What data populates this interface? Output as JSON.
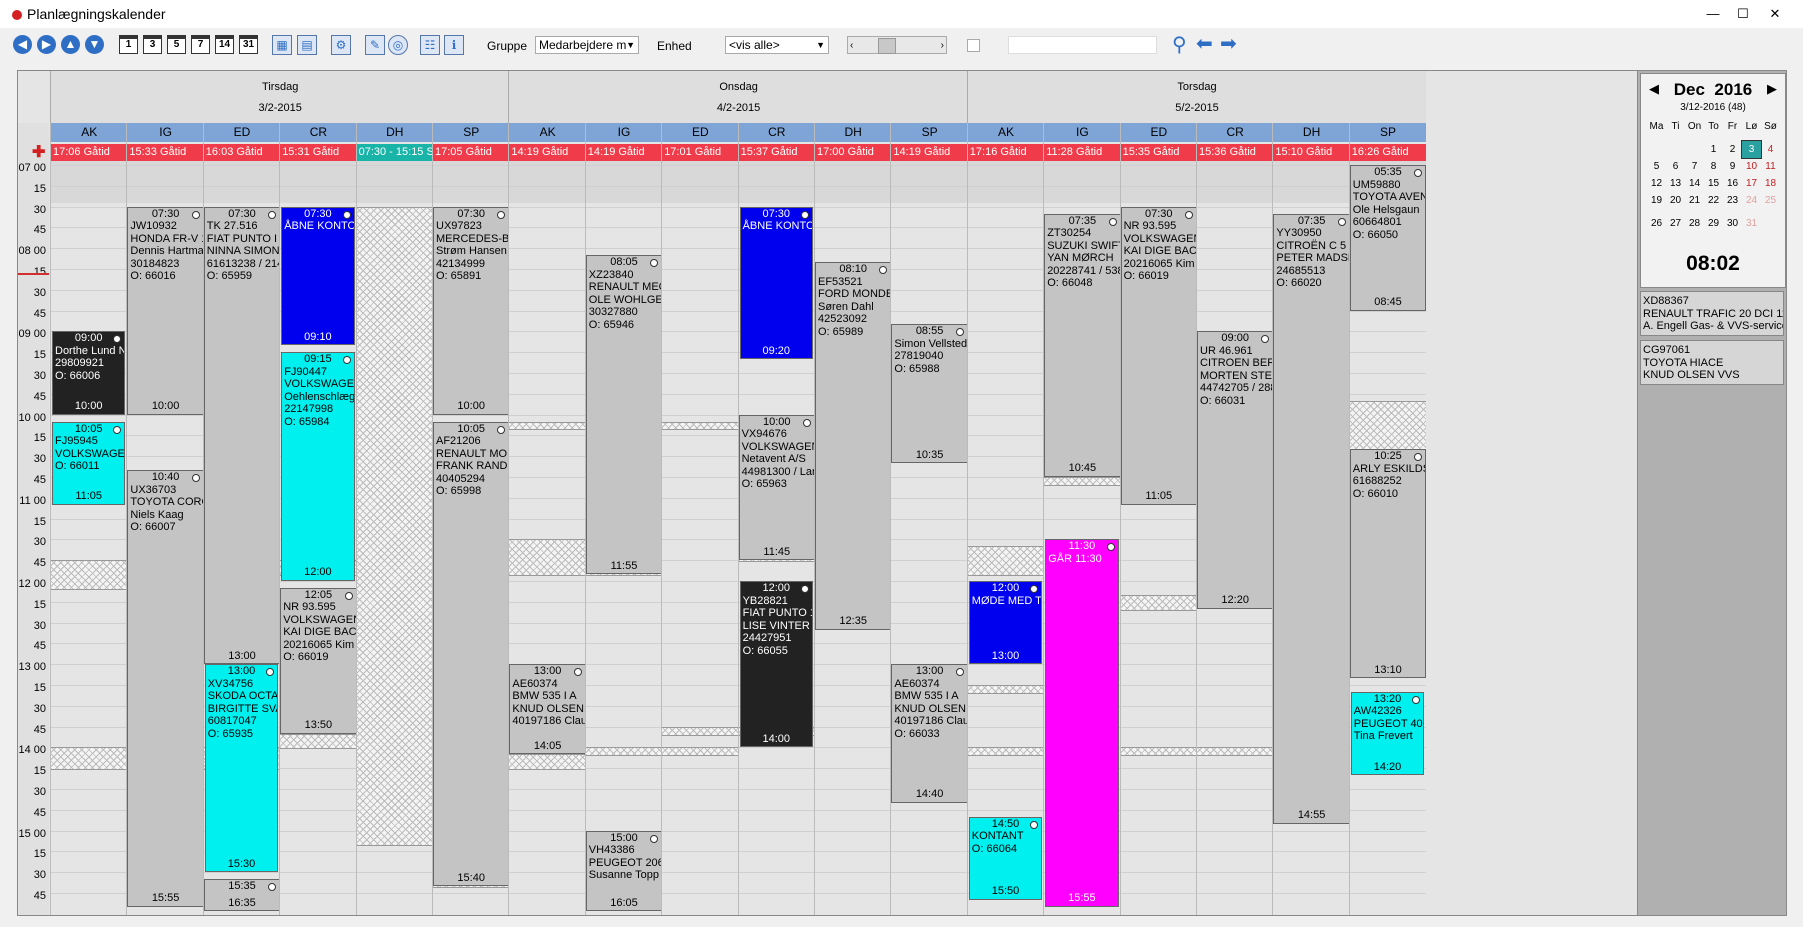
{
  "window": {
    "title": "Planlægningskalender",
    "min": "—",
    "max": "☐",
    "close": "✕"
  },
  "toolbar": {
    "nav_icons": [
      "left-arrow-icon",
      "right-arrow-icon",
      "up-arrow-icon",
      "down-arrow-icon"
    ],
    "day_buttons": [
      "1",
      "3",
      "5",
      "7",
      "14",
      "31"
    ],
    "gruppe_label": "Gruppe",
    "gruppe_value": "Medarbejdere m",
    "enhed_label": "Enhed",
    "enhed_value": "<vis alle>"
  },
  "days": [
    {
      "name": "Tirsdag",
      "date": "3/2-2015"
    },
    {
      "name": "Onsdag",
      "date": "4/2-2015"
    },
    {
      "name": "Torsdag",
      "date": "5/2-2015"
    }
  ],
  "columns": [
    {
      "abbr": "AK",
      "status": "17:06 Gåtid"
    },
    {
      "abbr": "IG",
      "status": "15:33 Gåtid"
    },
    {
      "abbr": "ED",
      "status": "16:03 Gåtid"
    },
    {
      "abbr": "CR",
      "status": "15:31 Gåtid"
    },
    {
      "abbr": "DH",
      "status": "07:30 - 15:15 Sy"
    },
    {
      "abbr": "SP",
      "status": "17:05 Gåtid"
    },
    {
      "abbr": "AK",
      "status": "14:19 Gåtid"
    },
    {
      "abbr": "IG",
      "status": "14:19 Gåtid"
    },
    {
      "abbr": "ED",
      "status": "17:01 Gåtid"
    },
    {
      "abbr": "CR",
      "status": "15:37 Gåtid"
    },
    {
      "abbr": "DH",
      "status": "17:00 Gåtid"
    },
    {
      "abbr": "SP",
      "status": "14:19 Gåtid"
    },
    {
      "abbr": "AK",
      "status": "17:16 Gåtid"
    },
    {
      "abbr": "IG",
      "status": "11:28 Gåtid"
    },
    {
      "abbr": "ED",
      "status": "15:35 Gåtid"
    },
    {
      "abbr": "CR",
      "status": "15:36 Gåtid"
    },
    {
      "abbr": "DH",
      "status": "15:10 Gåtid"
    },
    {
      "abbr": "SP",
      "status": "16:26 Gåtid"
    }
  ],
  "times": [
    "07 00",
    "15",
    "30",
    "45",
    "08 00",
    "15",
    "30",
    "45",
    "09 00",
    "15",
    "30",
    "45",
    "10 00",
    "15",
    "30",
    "45",
    "11 00",
    "15",
    "30",
    "45",
    "12 00",
    "15",
    "30",
    "45",
    "13 00",
    "15",
    "30",
    "45",
    "14 00",
    "15",
    "30",
    "45",
    "15 00",
    "15",
    "30",
    "45"
  ],
  "events": [
    {
      "col": 0,
      "start": "09:00",
      "end": "10:00",
      "color": "black",
      "text": "Dorthe Lund Niel\n29809921\nO: 66006"
    },
    {
      "col": 0,
      "start": "10:05",
      "end": "11:05",
      "color": "cyan",
      "text": "FJ95945\nVOLKSWAGEN\nO: 66011"
    },
    {
      "col": 1,
      "start": "07:30",
      "end": "10:00",
      "color": "gray",
      "text": "JW10932\nHONDA FR-V 18\nDennis Hartman\n30184823\nO: 66016"
    },
    {
      "col": 1,
      "start": "10:40",
      "end": "15:55",
      "color": "gray",
      "text": "UX36703\nTOYOTA CORO\nNiels Kaag\nO: 66007"
    },
    {
      "col": 2,
      "start": "07:30",
      "end": "13:00",
      "color": "gray",
      "text": "TK 27.516\nFIAT PUNTO I\nNINNA SIMONS\n61613238 / 214\nO: 65959"
    },
    {
      "col": 2,
      "start": "13:00",
      "end": "15:30",
      "color": "cyan",
      "text": "XV34756\nSKODA OCTAVI\nBIRGITTE SVA\n60817047\nO: 65935"
    },
    {
      "col": 2,
      "start": "15:35",
      "end": "16:35",
      "color": "gray",
      "text": ""
    },
    {
      "col": 3,
      "start": "07:30",
      "end": "09:10",
      "color": "blue",
      "text": "ÅBNE KONTOR"
    },
    {
      "col": 3,
      "start": "09:15",
      "end": "12:00",
      "color": "cyan",
      "text": "FJ90447\nVOLKSWAGEN\nOehlenschlæger\n22147998\nO: 65984"
    },
    {
      "col": 3,
      "start": "12:05",
      "end": "13:50",
      "color": "gray",
      "text": "NR 93.595\nVOLKSWAGEN\nKAI DIGE BACH\n20216065 Kim /\nO: 66019"
    },
    {
      "col": 5,
      "start": "07:30",
      "end": "10:00",
      "color": "gray",
      "text": "UX97823\nMERCEDES-BE\nStrøm Hansen A\n42134999\nO: 65891"
    },
    {
      "col": 5,
      "start": "10:05",
      "end": "15:40",
      "color": "gray",
      "text": "AF21206\nRENAULT MOD\nFRANK RANDL\n40405294\nO: 65998"
    },
    {
      "col": 6,
      "start": "13:00",
      "end": "14:05",
      "color": "gray",
      "text": "AE60374\nBMW 535 I A\nKNUD OLSEN V\n40197186 Claus"
    },
    {
      "col": 7,
      "start": "08:05",
      "end": "11:55",
      "color": "gray",
      "text": "XZ23840\nRENAULT MEG\nOLE WOHLGE\n30327880\nO: 65946"
    },
    {
      "col": 7,
      "start": "15:00",
      "end": "16:05",
      "color": "gray",
      "text": "VH43386\nPEUGEOT 206\nSusanne Topp"
    },
    {
      "col": 9,
      "start": "07:30",
      "end": "09:20",
      "color": "blue",
      "text": "ÅBNE KONTOR"
    },
    {
      "col": 9,
      "start": "10:00",
      "end": "11:45",
      "color": "gray",
      "text": "VX94676\nVOLKSWAGEN\nNetavent A/S\n44981300 / Lars\nO: 65963"
    },
    {
      "col": 9,
      "start": "12:00",
      "end": "14:00",
      "color": "black",
      "text": "YB28821\nFIAT PUNTO 12\nLISE VINTER\n24427951\nO: 66055"
    },
    {
      "col": 10,
      "start": "08:10",
      "end": "12:35",
      "color": "gray",
      "text": "EF53521\nFORD MONDEO\nSøren Dahl\n42523092\nO: 65989"
    },
    {
      "col": 11,
      "start": "08:55",
      "end": "10:35",
      "color": "gray",
      "text": "Simon Vellsted\n27819040\nO: 65988"
    },
    {
      "col": 11,
      "start": "13:00",
      "end": "14:40",
      "color": "gray",
      "text": "AE60374\nBMW 535 I A\nKNUD OLSEN V\n40197186 Claus\nO: 66033"
    },
    {
      "col": 12,
      "start": "12:00",
      "end": "13:00",
      "color": "blue",
      "text": "MØDE MED TE"
    },
    {
      "col": 12,
      "start": "14:50",
      "end": "15:50",
      "color": "cyan",
      "text": "KONTANT\nO: 66064"
    },
    {
      "col": 13,
      "start": "07:35",
      "end": "10:45",
      "color": "gray",
      "text": "ZT30254\nSUZUKI SWIFT\nYAN MØRCH\n20228741 / 538\nO: 66048"
    },
    {
      "col": 13,
      "start": "11:30",
      "end": "15:55",
      "color": "magenta",
      "text": "GÅR 11:30"
    },
    {
      "col": 14,
      "start": "07:30",
      "end": "11:05",
      "color": "gray",
      "text": "NR 93.595\nVOLKSWAGEN\nKAI DIGE BACH\n20216065 Kim /\nO: 66019"
    },
    {
      "col": 15,
      "start": "09:00",
      "end": "12:20",
      "color": "gray",
      "text": "UR 46.961\nCITROEN BERL\nMORTEN STEF\n44742705 / 288\nO: 66031"
    },
    {
      "col": 16,
      "start": "07:35",
      "end": "14:55",
      "color": "gray",
      "text": "YY30950\nCITROËN C 5 1\nPETER MADSE\n24685513\nO: 66020"
    },
    {
      "col": 17,
      "start": "05:35",
      "end": "08:45",
      "color": "gray",
      "text": "UM59880\nTOYOTA AVEN\nOle Helsgaun\n60664801\nO: 66050"
    },
    {
      "col": 17,
      "start": "10:25",
      "end": "13:10",
      "color": "gray",
      "text": "ARLY ESKILDS\n61688252\nO: 66010"
    },
    {
      "col": 17,
      "start": "13:20",
      "end": "14:20",
      "color": "cyan",
      "text": "AW42326\nPEUGEOT 407\nTina Frevert"
    }
  ],
  "minical": {
    "month": "Dec",
    "year": "2016",
    "sub": "3/12-2016 (48)",
    "weekdays": [
      "Ma",
      "Ti",
      "On",
      "To",
      "Fr",
      "Lø",
      "Sø"
    ],
    "days": [
      "",
      "",
      "",
      "1",
      "2",
      "3",
      "4",
      "5",
      "6",
      "7",
      "8",
      "9",
      "10",
      "11",
      "12",
      "13",
      "14",
      "15",
      "16",
      "17",
      "18",
      "19",
      "20",
      "21",
      "22",
      "23",
      "24",
      "25",
      "26",
      "27",
      "28",
      "29",
      "30",
      "31",
      ""
    ],
    "time": "08:02"
  },
  "side_items": [
    {
      "text": "XD88367\nRENAULT TRAFIC 20 DCI 11\nA. Engell Gas- & VVS-service"
    },
    {
      "text": "CG97061\nTOYOTA HIACE\nKNUD OLSEN VVS"
    }
  ]
}
